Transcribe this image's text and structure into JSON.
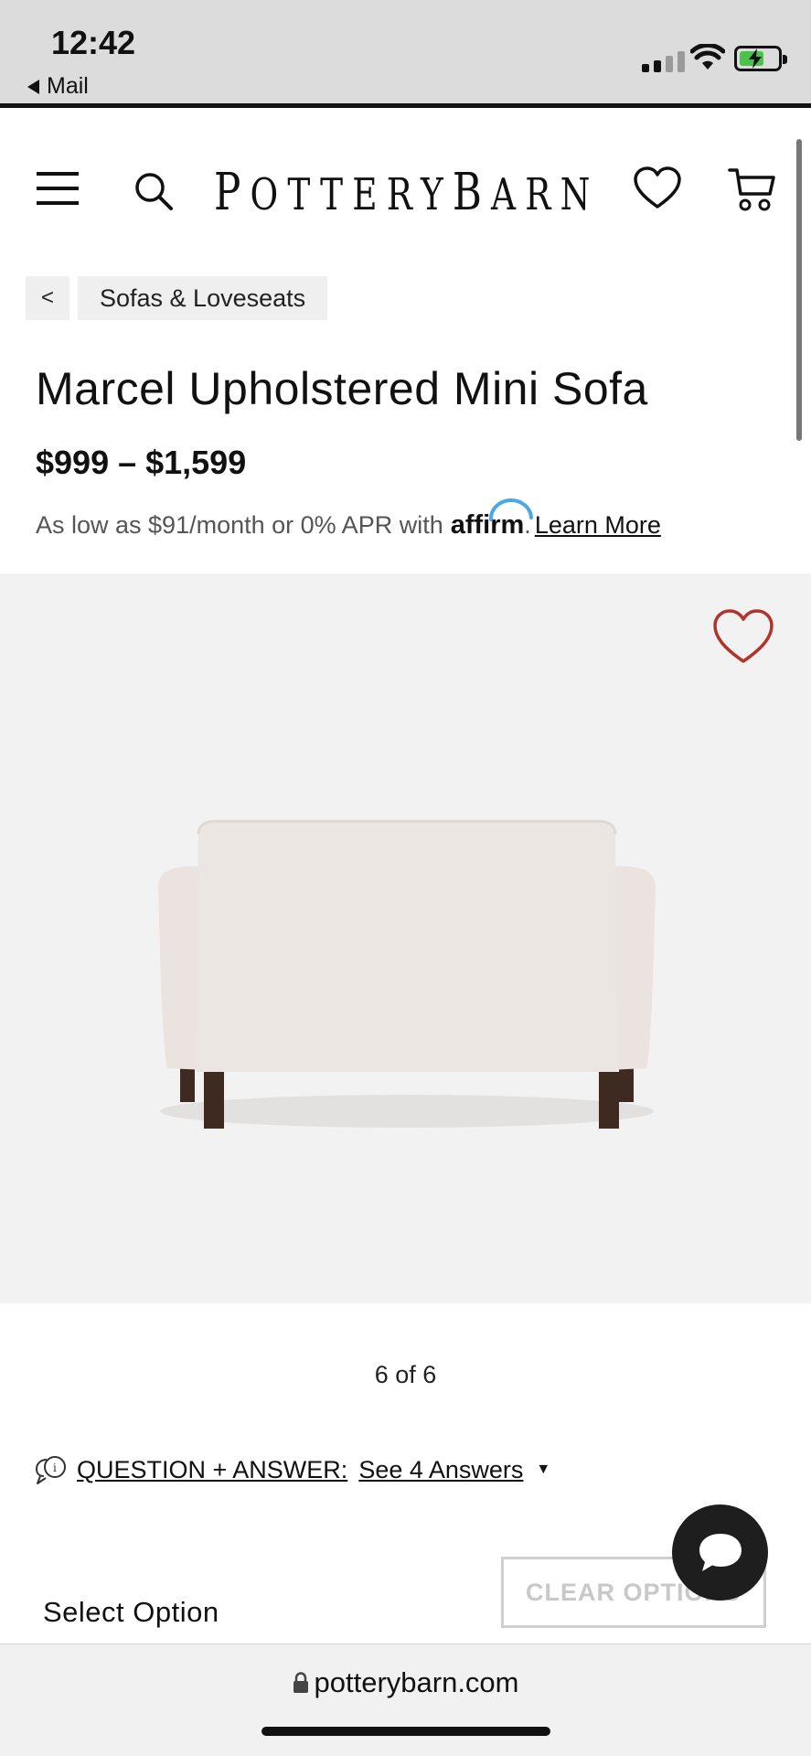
{
  "status_bar": {
    "time": "12:42",
    "back_app": "Mail"
  },
  "header": {
    "logo_letters": [
      "P",
      "O",
      "T",
      "T",
      "E",
      "R",
      "Y",
      "B",
      "A",
      "R",
      "N"
    ],
    "icons": [
      "menu-icon",
      "search-icon",
      "heart-icon",
      "cart-icon"
    ]
  },
  "breadcrumb": {
    "back": "<",
    "label": "Sofas & Loveseats"
  },
  "product": {
    "title": "Marcel Upholstered Mini Sofa",
    "price": "$999 – $1,599",
    "financing_text": "As low as $91/month or 0% APR with",
    "financing_brand": "affirm",
    "financing_suffix": ".",
    "learn_more": "Learn More"
  },
  "gallery": {
    "counter": "6 of 6",
    "favorite_color": "#b0332c",
    "background": "#f3f2f2"
  },
  "qa": {
    "label": "QUESTION + ANSWER:",
    "answers": "See 4 Answers",
    "caret": "▼"
  },
  "options": {
    "clear_label": "CLEAR OPTIONS",
    "select_label": "Select Option"
  },
  "browser": {
    "url": "potterybarn.com"
  }
}
